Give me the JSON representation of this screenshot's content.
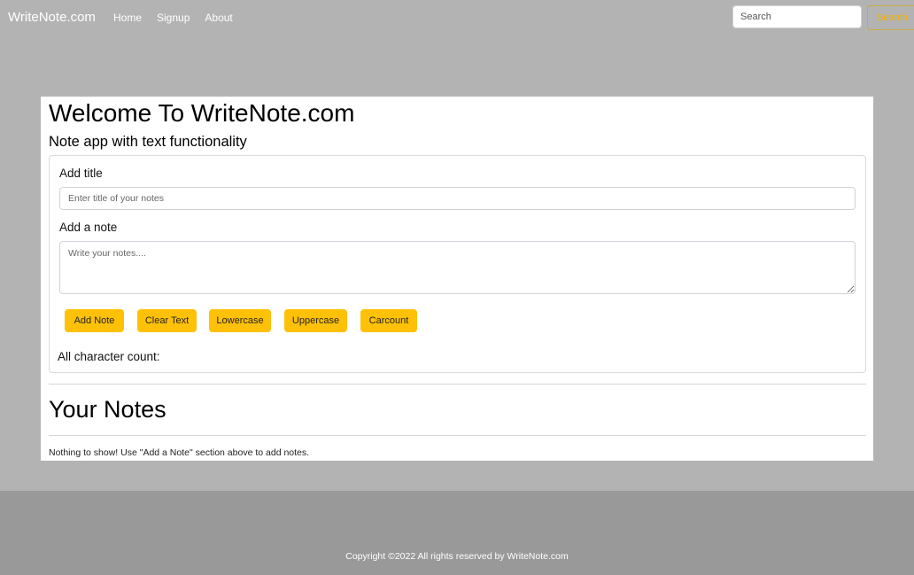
{
  "navbar": {
    "brand": "WriteNote.com",
    "links": [
      "Home",
      "Signup",
      "About"
    ],
    "search_placeholder": "Search",
    "search_button": "Search"
  },
  "main": {
    "title": "Welcome To WriteNote.com",
    "subtitle": "Note app with text functionality",
    "form": {
      "title_label": "Add title",
      "title_placeholder": "Enter title of your notes",
      "title_value": "",
      "note_label": "Add a note",
      "note_placeholder": "Write your notes....",
      "note_value": "",
      "buttons": [
        "Add Note",
        "Clear Text",
        "Lowercase",
        "Uppercase",
        "Carcount"
      ],
      "char_count_label": "All character count:"
    },
    "notes_heading": "Your Notes",
    "empty_message": "Nothing to show! Use \"Add a Note\" section above to add notes."
  },
  "footer": {
    "copyright": "Copyright ©2022 All rights reserved by WriteNote.com"
  },
  "colors": {
    "page_background": "#b3b3b3",
    "footer_background": "#999999",
    "accent": "#ffc107"
  }
}
